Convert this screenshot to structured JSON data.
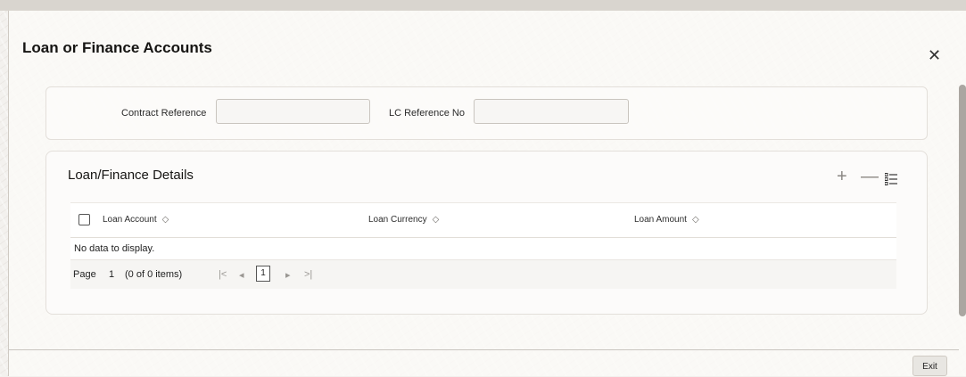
{
  "dialog": {
    "title": "Loan or Finance Accounts",
    "close_icon": "close-icon"
  },
  "criteria": {
    "contract_reference_label": "Contract Reference",
    "contract_reference_value": "",
    "lc_reference_label": "LC Reference No",
    "lc_reference_value": ""
  },
  "details": {
    "title": "Loan/Finance Details",
    "add_icon": "plus-icon",
    "remove_icon": "minus-icon",
    "columns_icon": "column-list-icon",
    "columns": [
      {
        "label": "Loan Account"
      },
      {
        "label": "Loan Currency"
      },
      {
        "label": "Loan Amount"
      }
    ],
    "empty_message": "No data to display.",
    "pager": {
      "page_label": "Page",
      "page_number": "1",
      "items_info": "(0 of 0 items)",
      "current_page": "1",
      "first_icon": "|<",
      "prev_icon": "◂",
      "next_icon": "▸",
      "last_icon": ">|"
    }
  },
  "footer": {
    "exit_label": "Exit"
  },
  "colors": {
    "background": "#f3f1ee",
    "panel": "#fcfbfa",
    "text": "#161513"
  }
}
